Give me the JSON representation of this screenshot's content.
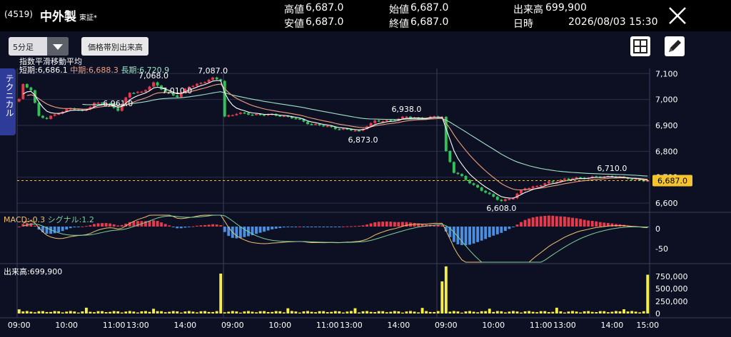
{
  "header": {
    "code": "(4519)",
    "name": "中外製",
    "market": "東証*",
    "high_label": "高値",
    "high": "6,687.0",
    "low_label": "安値",
    "low": "6,687.0",
    "open_label": "始値",
    "open": "6,687.0",
    "close_label": "終値",
    "close": "6,687.0",
    "volume_label": "出来高",
    "volume": "699,900",
    "datetime_label": "日時",
    "datetime": "2026/08/03 15:30"
  },
  "toolbar": {
    "timeframe": "5分足",
    "price_volume_button": "価格帯別出来高",
    "layout_icon": "grid-icon",
    "draw_icon": "pencil-icon"
  },
  "side_tab": "テクニカル",
  "ema": {
    "title": "指数平滑移動平均",
    "short_label": "短期",
    "short": "6,686.1",
    "mid_label": "中期",
    "mid": "6,688.3",
    "long_label": "長期",
    "long": "6,720.9"
  },
  "macd": {
    "label": "MACD",
    "value": "-0.3",
    "signal_label": "シグナル",
    "signal": "1.2"
  },
  "volume_panel": {
    "label": "出来高",
    "value": "699,900"
  },
  "colors": {
    "up": "#e8394d",
    "down": "#2fc457",
    "short_ema": "#ffffff",
    "mid_ema": "#f0a080",
    "long_ema": "#9fe0c8",
    "volume": "#f4ee46",
    "hist_up": "#e8394d",
    "hist_down": "#4a90e2",
    "macd_line": "#f0c070",
    "signal_line": "#7fd09a",
    "current_price": "#f4c430"
  },
  "chart_data": {
    "type": "candlestick",
    "y_axis": {
      "ticks": [
        "7,100",
        "7,000",
        "6,900",
        "6,800",
        "6,700",
        "6,600"
      ],
      "ylim": [
        6570,
        7120
      ]
    },
    "current_price": {
      "value": 6687,
      "label": "6,687.0"
    },
    "macd_axis": {
      "ticks": [
        "0",
        "-50"
      ]
    },
    "volume_axis": {
      "ticks": [
        "750,000",
        "500,000",
        "250,000",
        "0"
      ]
    },
    "x_ticks": [
      "09:00",
      "10:00",
      "11:00",
      "13:00",
      "14:00",
      "09:00",
      "10:00",
      "11:00",
      "13:00",
      "14:00",
      "09:00",
      "10:00",
      "11:00",
      "13:00",
      "14:00",
      "15:00"
    ],
    "annotations": [
      {
        "label": "7,068.0",
        "index": 34,
        "value": 7068
      },
      {
        "label": "7,087.0",
        "index": 49,
        "value": 7087
      },
      {
        "label": "6,961.0",
        "index": 25,
        "value": 6961
      },
      {
        "label": "7,010.0",
        "index": 40,
        "value": 7010
      },
      {
        "label": "6,938.0",
        "index": 98,
        "value": 6938
      },
      {
        "label": "6,873.0",
        "index": 87,
        "value": 6873
      },
      {
        "label": "6,710.0",
        "index": 150,
        "value": 6710
      },
      {
        "label": "6,608.0",
        "index": 122,
        "value": 6608
      }
    ],
    "anchors": [
      [
        0,
        7000
      ],
      [
        1,
        7055
      ],
      [
        3,
        7040
      ],
      [
        5,
        6935
      ],
      [
        7,
        6925
      ],
      [
        10,
        6950
      ],
      [
        13,
        6965
      ],
      [
        16,
        6955
      ],
      [
        19,
        6985
      ],
      [
        22,
        6985
      ],
      [
        25,
        6961
      ],
      [
        28,
        7025
      ],
      [
        31,
        7030
      ],
      [
        34,
        7062
      ],
      [
        37,
        7030
      ],
      [
        40,
        7012
      ],
      [
        43,
        7050
      ],
      [
        46,
        7065
      ],
      [
        49,
        7080
      ],
      [
        51,
        7075
      ],
      [
        52,
        6935
      ],
      [
        55,
        6945
      ],
      [
        58,
        6945
      ],
      [
        62,
        6940
      ],
      [
        66,
        6940
      ],
      [
        70,
        6925
      ],
      [
        74,
        6905
      ],
      [
        78,
        6895
      ],
      [
        82,
        6885
      ],
      [
        86,
        6878
      ],
      [
        88,
        6900
      ],
      [
        90,
        6915
      ],
      [
        94,
        6920
      ],
      [
        98,
        6932
      ],
      [
        102,
        6928
      ],
      [
        106,
        6932
      ],
      [
        107,
        6935
      ],
      [
        108,
        6800
      ],
      [
        110,
        6720
      ],
      [
        113,
        6690
      ],
      [
        116,
        6660
      ],
      [
        119,
        6630
      ],
      [
        122,
        6610
      ],
      [
        125,
        6620
      ],
      [
        128,
        6660
      ],
      [
        131,
        6665
      ],
      [
        134,
        6680
      ],
      [
        137,
        6690
      ],
      [
        140,
        6695
      ],
      [
        144,
        6700
      ],
      [
        148,
        6700
      ],
      [
        150,
        6706
      ],
      [
        153,
        6695
      ],
      [
        156,
        6692
      ],
      [
        159,
        6687
      ]
    ],
    "volume_spikes": [
      [
        51,
        720000
      ],
      [
        107,
        580000
      ],
      [
        108,
        850000
      ],
      [
        159,
        699900
      ]
    ]
  }
}
